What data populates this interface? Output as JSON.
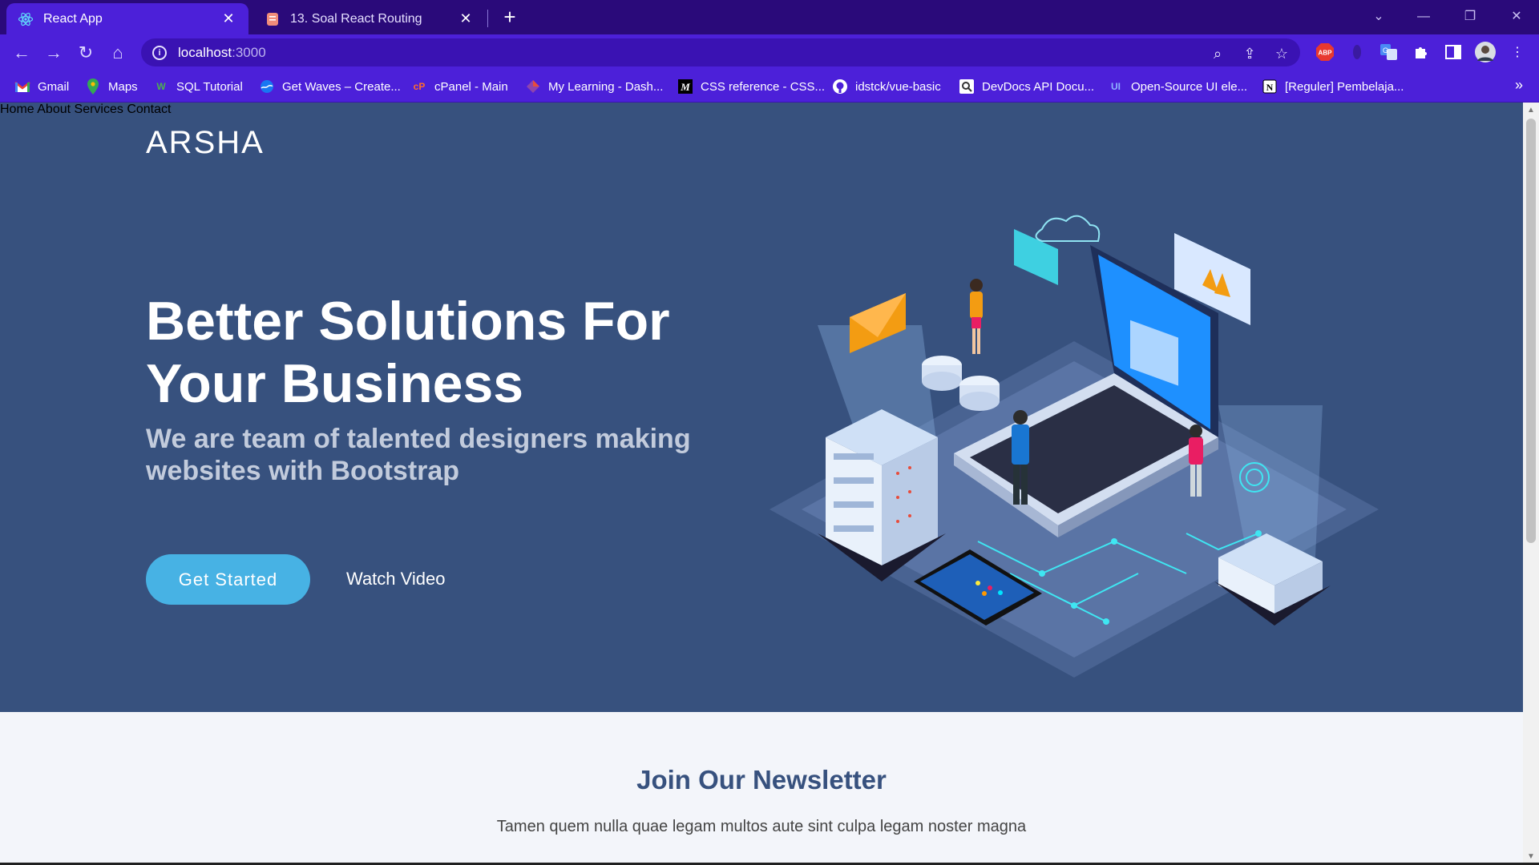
{
  "browser": {
    "tabs": [
      {
        "title": "React App",
        "active": true
      },
      {
        "title": "13. Soal React Routing",
        "active": false
      }
    ],
    "address": {
      "host": "localhost",
      "port": ":3000"
    },
    "bookmarks": [
      "Gmail",
      "Maps",
      "SQL Tutorial",
      "Get Waves – Create...",
      "cPanel - Main",
      "My Learning - Dash...",
      "CSS reference - CSS...",
      "idstck/vue-basic",
      "DevDocs API Docu...",
      "Open-Source UI ele...",
      "[Reguler] Pembelaja..."
    ],
    "more_bookmarks": "»",
    "extension_abp": "ABP",
    "colors": {
      "tabbar": "#2a0a7a",
      "toolbar": "#4c20d9"
    }
  },
  "site": {
    "logo": "ARSHA",
    "nav": [
      "Home",
      "About",
      "Services",
      "Contact"
    ],
    "hero": {
      "title": "Better Solutions For Your Business",
      "subtitle": "We are team of talented designers making websites with Bootstrap",
      "cta_primary": "Get Started",
      "cta_secondary": "Watch Video"
    },
    "newsletter": {
      "title": "Join Our Newsletter",
      "text": "Tamen quem nulla quae legam multos aute sint culpa legam noster magna"
    },
    "colors": {
      "hero_bg": "#37517e",
      "accent": "#47b2e4",
      "newsletter_bg": "#f3f5fa"
    }
  }
}
